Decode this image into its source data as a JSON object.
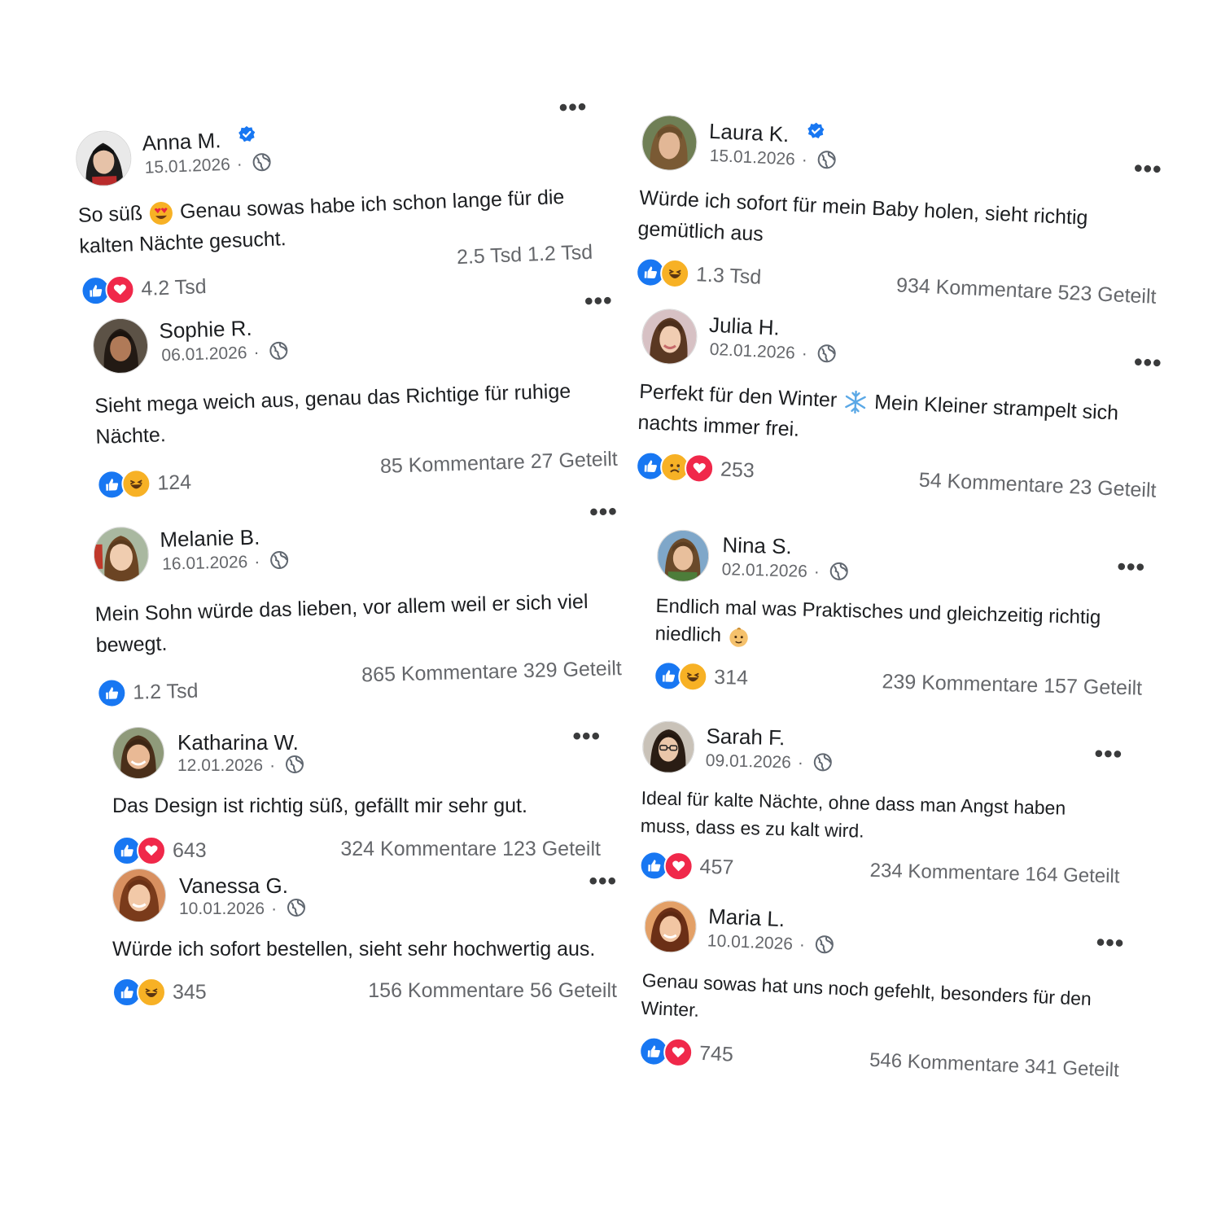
{
  "colors": {
    "like": "#1877f2",
    "love": "#f0284a",
    "haha": "#f7b125",
    "verified": "#1877f2",
    "muted": "#65676b"
  },
  "icons": {
    "more": "more-horizontal-icon",
    "globe": "globe-icon",
    "verified": "verified-badge-icon"
  },
  "posts": [
    {
      "name": "Anna M.",
      "verified": true,
      "date": "15.01.2026",
      "sep": "·",
      "more": "•••",
      "text_a": "So süß",
      "emoji": "heart-eyes-emoji",
      "text_b": "Genau sowas habe ich schon lange für die kalten Nächte gesucht.",
      "reactions": [
        "like",
        "love"
      ],
      "reaction_count": "4.2 Tsd",
      "stats": "2.5 Tsd 1.2 Tsd"
    },
    {
      "name": "Sophie R.",
      "verified": false,
      "date": "06.01.2026",
      "sep": "·",
      "more": "•••",
      "text_a": "Sieht mega weich aus, genau das Richtige für ruhige Nächte.",
      "reactions": [
        "like",
        "haha"
      ],
      "reaction_count": "124",
      "stats": "85 Kommentare 27 Geteilt"
    },
    {
      "name": "Melanie B.",
      "verified": false,
      "date": "16.01.2026",
      "sep": "·",
      "more": "•••",
      "text_a": "Mein Sohn würde das lieben, vor allem weil er sich viel bewegt.",
      "reactions": [
        "like"
      ],
      "reaction_count": "1.2 Tsd",
      "stats": "865 Kommentare 329 Geteilt"
    },
    {
      "name": "Katharina W.",
      "verified": false,
      "date": "12.01.2026",
      "sep": "·",
      "more": "•••",
      "text_a": "Das Design ist richtig süß, gefällt mir sehr gut.",
      "reactions": [
        "like",
        "love"
      ],
      "reaction_count": "643",
      "stats": "324 Kommentare 123 Geteilt"
    },
    {
      "name": "Vanessa G.",
      "verified": false,
      "date": "10.01.2026",
      "sep": "·",
      "more": "•••",
      "text_a": "Würde ich sofort bestellen, sieht sehr hochwertig aus.",
      "reactions": [
        "like",
        "haha"
      ],
      "reaction_count": "345",
      "stats": "156 Kommentare 56 Geteilt"
    },
    {
      "name": "Laura K.",
      "verified": true,
      "date": "15.01.2026",
      "sep": "·",
      "more": "•••",
      "text_a": "Würde ich sofort für mein Baby holen, sieht richtig gemütlich aus",
      "reactions": [
        "like",
        "haha"
      ],
      "reaction_count": "1.3 Tsd",
      "stats": "934 Kommentare 523 Geteilt"
    },
    {
      "name": "Julia H.",
      "verified": false,
      "date": "02.01.2026",
      "sep": "·",
      "more": "•••",
      "text_a": "Perfekt für den Winter",
      "emoji": "snowflake-emoji",
      "text_b": "Mein Kleiner strampelt sich nachts immer frei.",
      "reactions": [
        "like",
        "sad",
        "love"
      ],
      "reaction_count": "253",
      "stats": "54 Kommentare 23 Geteilt"
    },
    {
      "name": "Nina S.",
      "verified": false,
      "date": "02.01.2026",
      "sep": "·",
      "more": "•••",
      "text_a": "Endlich mal was Praktisches und gleichzeitig richtig niedlich",
      "emoji_end": "baby-emoji",
      "reactions": [
        "like",
        "haha"
      ],
      "reaction_count": "314",
      "stats": "239 Kommentare 157 Geteilt"
    },
    {
      "name": "Sarah F.",
      "verified": false,
      "date": "09.01.2026",
      "sep": "·",
      "more": "•••",
      "text_a": "Ideal für kalte Nächte, ohne dass man Angst haben muss, dass es zu kalt wird.",
      "reactions": [
        "like",
        "love"
      ],
      "reaction_count": "457",
      "stats": "234 Kommentare 164 Geteilt"
    },
    {
      "name": "Maria L.",
      "verified": false,
      "date": "10.01.2026",
      "sep": "·",
      "more": "•••",
      "text_a": "Genau sowas hat uns noch gefehlt, besonders für den Winter.",
      "reactions": [
        "like",
        "love"
      ],
      "reaction_count": "745",
      "stats": "546 Kommentare 341 Geteilt"
    }
  ]
}
